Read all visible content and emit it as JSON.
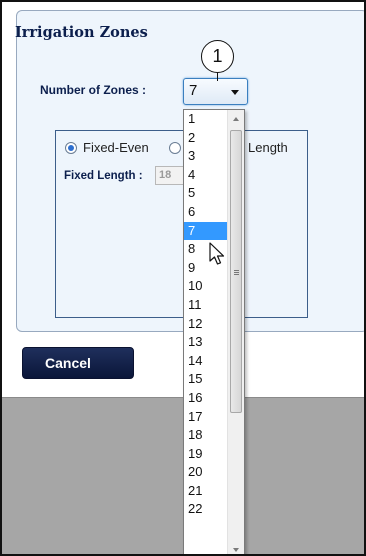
{
  "panel": {
    "title": "Irrigation Zones"
  },
  "zones": {
    "label": "Number of Zones :",
    "selected": "7"
  },
  "callout": {
    "number": "1"
  },
  "mode": {
    "option_fixed_even": "Fixed-Even",
    "option_fixed_length_partial": "Length"
  },
  "fixed_length": {
    "label": "Fixed Length :",
    "value": "18"
  },
  "buttons": {
    "cancel": "Cancel"
  },
  "dropdown": {
    "options": [
      "1",
      "2",
      "3",
      "4",
      "5",
      "6",
      "7",
      "8",
      "9",
      "10",
      "11",
      "12",
      "13",
      "14",
      "15",
      "16",
      "17",
      "18",
      "19",
      "20",
      "21",
      "22"
    ],
    "selected": "7",
    "highlight_color": "#3399ff"
  },
  "icons": {
    "combo_arrow": "chevron-down-icon",
    "cursor": "mouse-pointer-icon"
  }
}
